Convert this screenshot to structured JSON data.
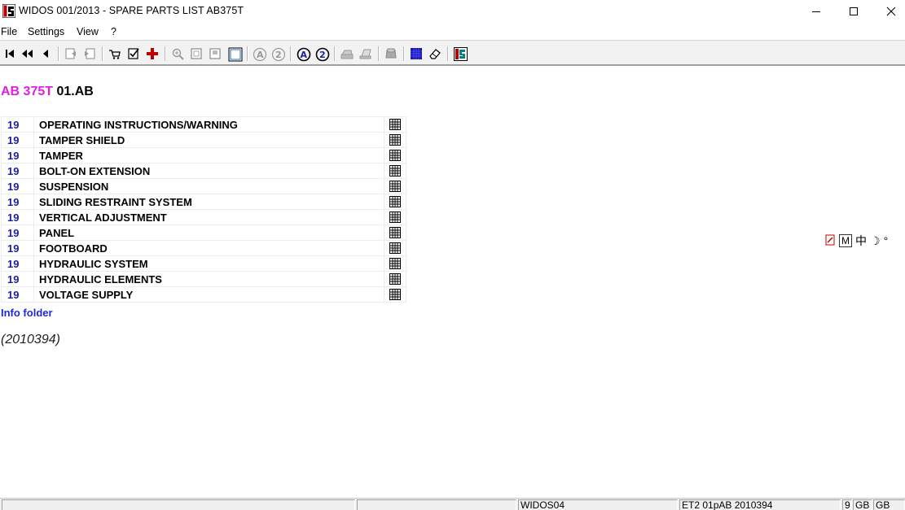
{
  "window": {
    "title": "WIDOS 001/2013 - SPARE PARTS LIST AB375T",
    "minimize_symbol": "—",
    "maximize_symbol": "☐",
    "close_symbol": "✕"
  },
  "menu": {
    "items": [
      {
        "label": "File"
      },
      {
        "label": "Settings"
      },
      {
        "label": "View"
      },
      {
        "label": "?"
      }
    ]
  },
  "toolbar": {
    "buttons": [
      "first-page-icon",
      "previous-fast-icon",
      "previous-icon",
      "back-document-icon",
      "forward-document-icon",
      "cart-icon",
      "checklist-icon",
      "add-red-cross-icon",
      "zoom-in-icon",
      "page-icon",
      "page-copy-icon",
      "frame-icon",
      "search-a-icon",
      "search-2-icon",
      "search-a-active-icon",
      "search-2-active-icon",
      "print-icon",
      "print-preview-icon",
      "archive-icon",
      "blue-grid-icon",
      "eraser-icon",
      "widos-logo-icon"
    ]
  },
  "heading": {
    "model": "AB 375T",
    "code": "01.AB"
  },
  "parts": [
    {
      "num": "19",
      "label": "OPERATING INSTRUCTIONS/WARNING"
    },
    {
      "num": "19",
      "label": "TAMPER SHIELD"
    },
    {
      "num": "19",
      "label": "TAMPER"
    },
    {
      "num": "19",
      "label": "BOLT-ON EXTENSION"
    },
    {
      "num": "19",
      "label": "SUSPENSION"
    },
    {
      "num": "19",
      "label": "SLIDING RESTRAINT SYSTEM"
    },
    {
      "num": "19",
      "label": "VERTICAL ADJUSTMENT"
    },
    {
      "num": "19",
      "label": "PANEL"
    },
    {
      "num": "19",
      "label": "FOOTBOARD"
    },
    {
      "num": "19",
      "label": "HYDRAULIC SYSTEM"
    },
    {
      "num": "19",
      "label": "HYDRAULIC ELEMENTS"
    },
    {
      "num": "19",
      "label": "VOLTAGE SUPPLY"
    }
  ],
  "info_folder": "Info folder",
  "document_id": "(2010394)",
  "ime_bar": {
    "mode": "M",
    "lang": "中",
    "moon": "☽",
    "dot": "°"
  },
  "statusbar": {
    "panels": [
      "",
      "",
      "WIDOS04",
      "ET2 01pAB 2010394",
      "9",
      "GB",
      "GB"
    ]
  },
  "colors": {
    "model_accent": "#e020e0",
    "number_blue": "#1e1ea8",
    "link_blue": "#1e2ad8",
    "add_red": "#c00000"
  }
}
